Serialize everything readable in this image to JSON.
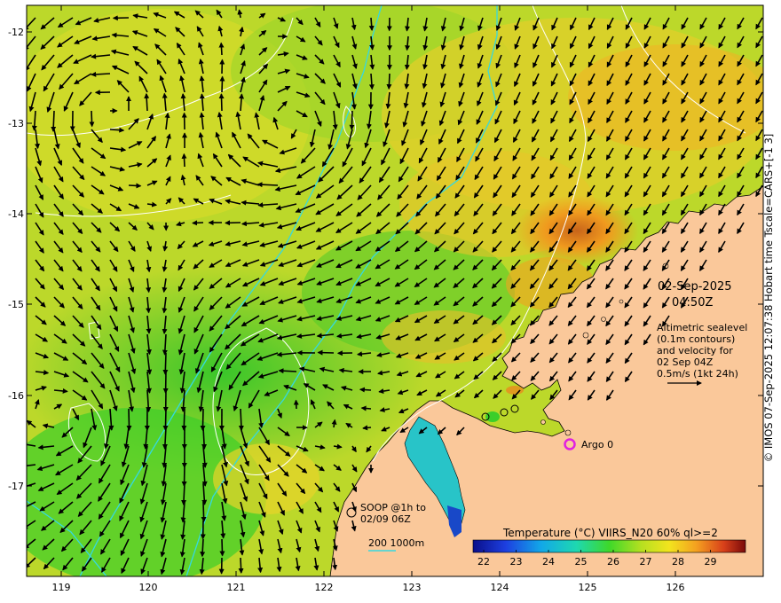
{
  "map": {
    "date": "02-Sep-2025",
    "time": "04:50Z",
    "legend_lines": [
      "Altimetric sealevel",
      "(0.1m contours)",
      "and velocity for",
      "02 Sep 04Z",
      "0.5m/s (1kt 24h)"
    ],
    "argo_label": "Argo 0",
    "soop_lines": [
      "SOOP @1h to",
      "02/09 06Z"
    ],
    "depth_label": "200  1000m",
    "colorbar_title": "Temperature (°C) VIIRS_N20 60% ql>=2",
    "colorbar_ticks": [
      "22",
      "23",
      "24",
      "25",
      "26",
      "27",
      "28",
      "29"
    ],
    "lat_ticks": [
      "-12",
      "-13",
      "-14",
      "-15",
      "-16",
      "-17"
    ],
    "lon_ticks": [
      "119",
      "120",
      "121",
      "122",
      "123",
      "124",
      "125",
      "126"
    ],
    "credit": "© IMOS 07-Sep-2025 12:07:38 Hobart time Tscale=CARS+[-1 3]"
  },
  "colors": {
    "ocean_warm": "#c9dc2a",
    "ocean_green": "#3fcf2a",
    "ocean_orange": "#f0a81e",
    "land": "#fac89a",
    "contour": "#ffffff",
    "isobath": "#35d8e0",
    "argo": "#e020e0"
  }
}
